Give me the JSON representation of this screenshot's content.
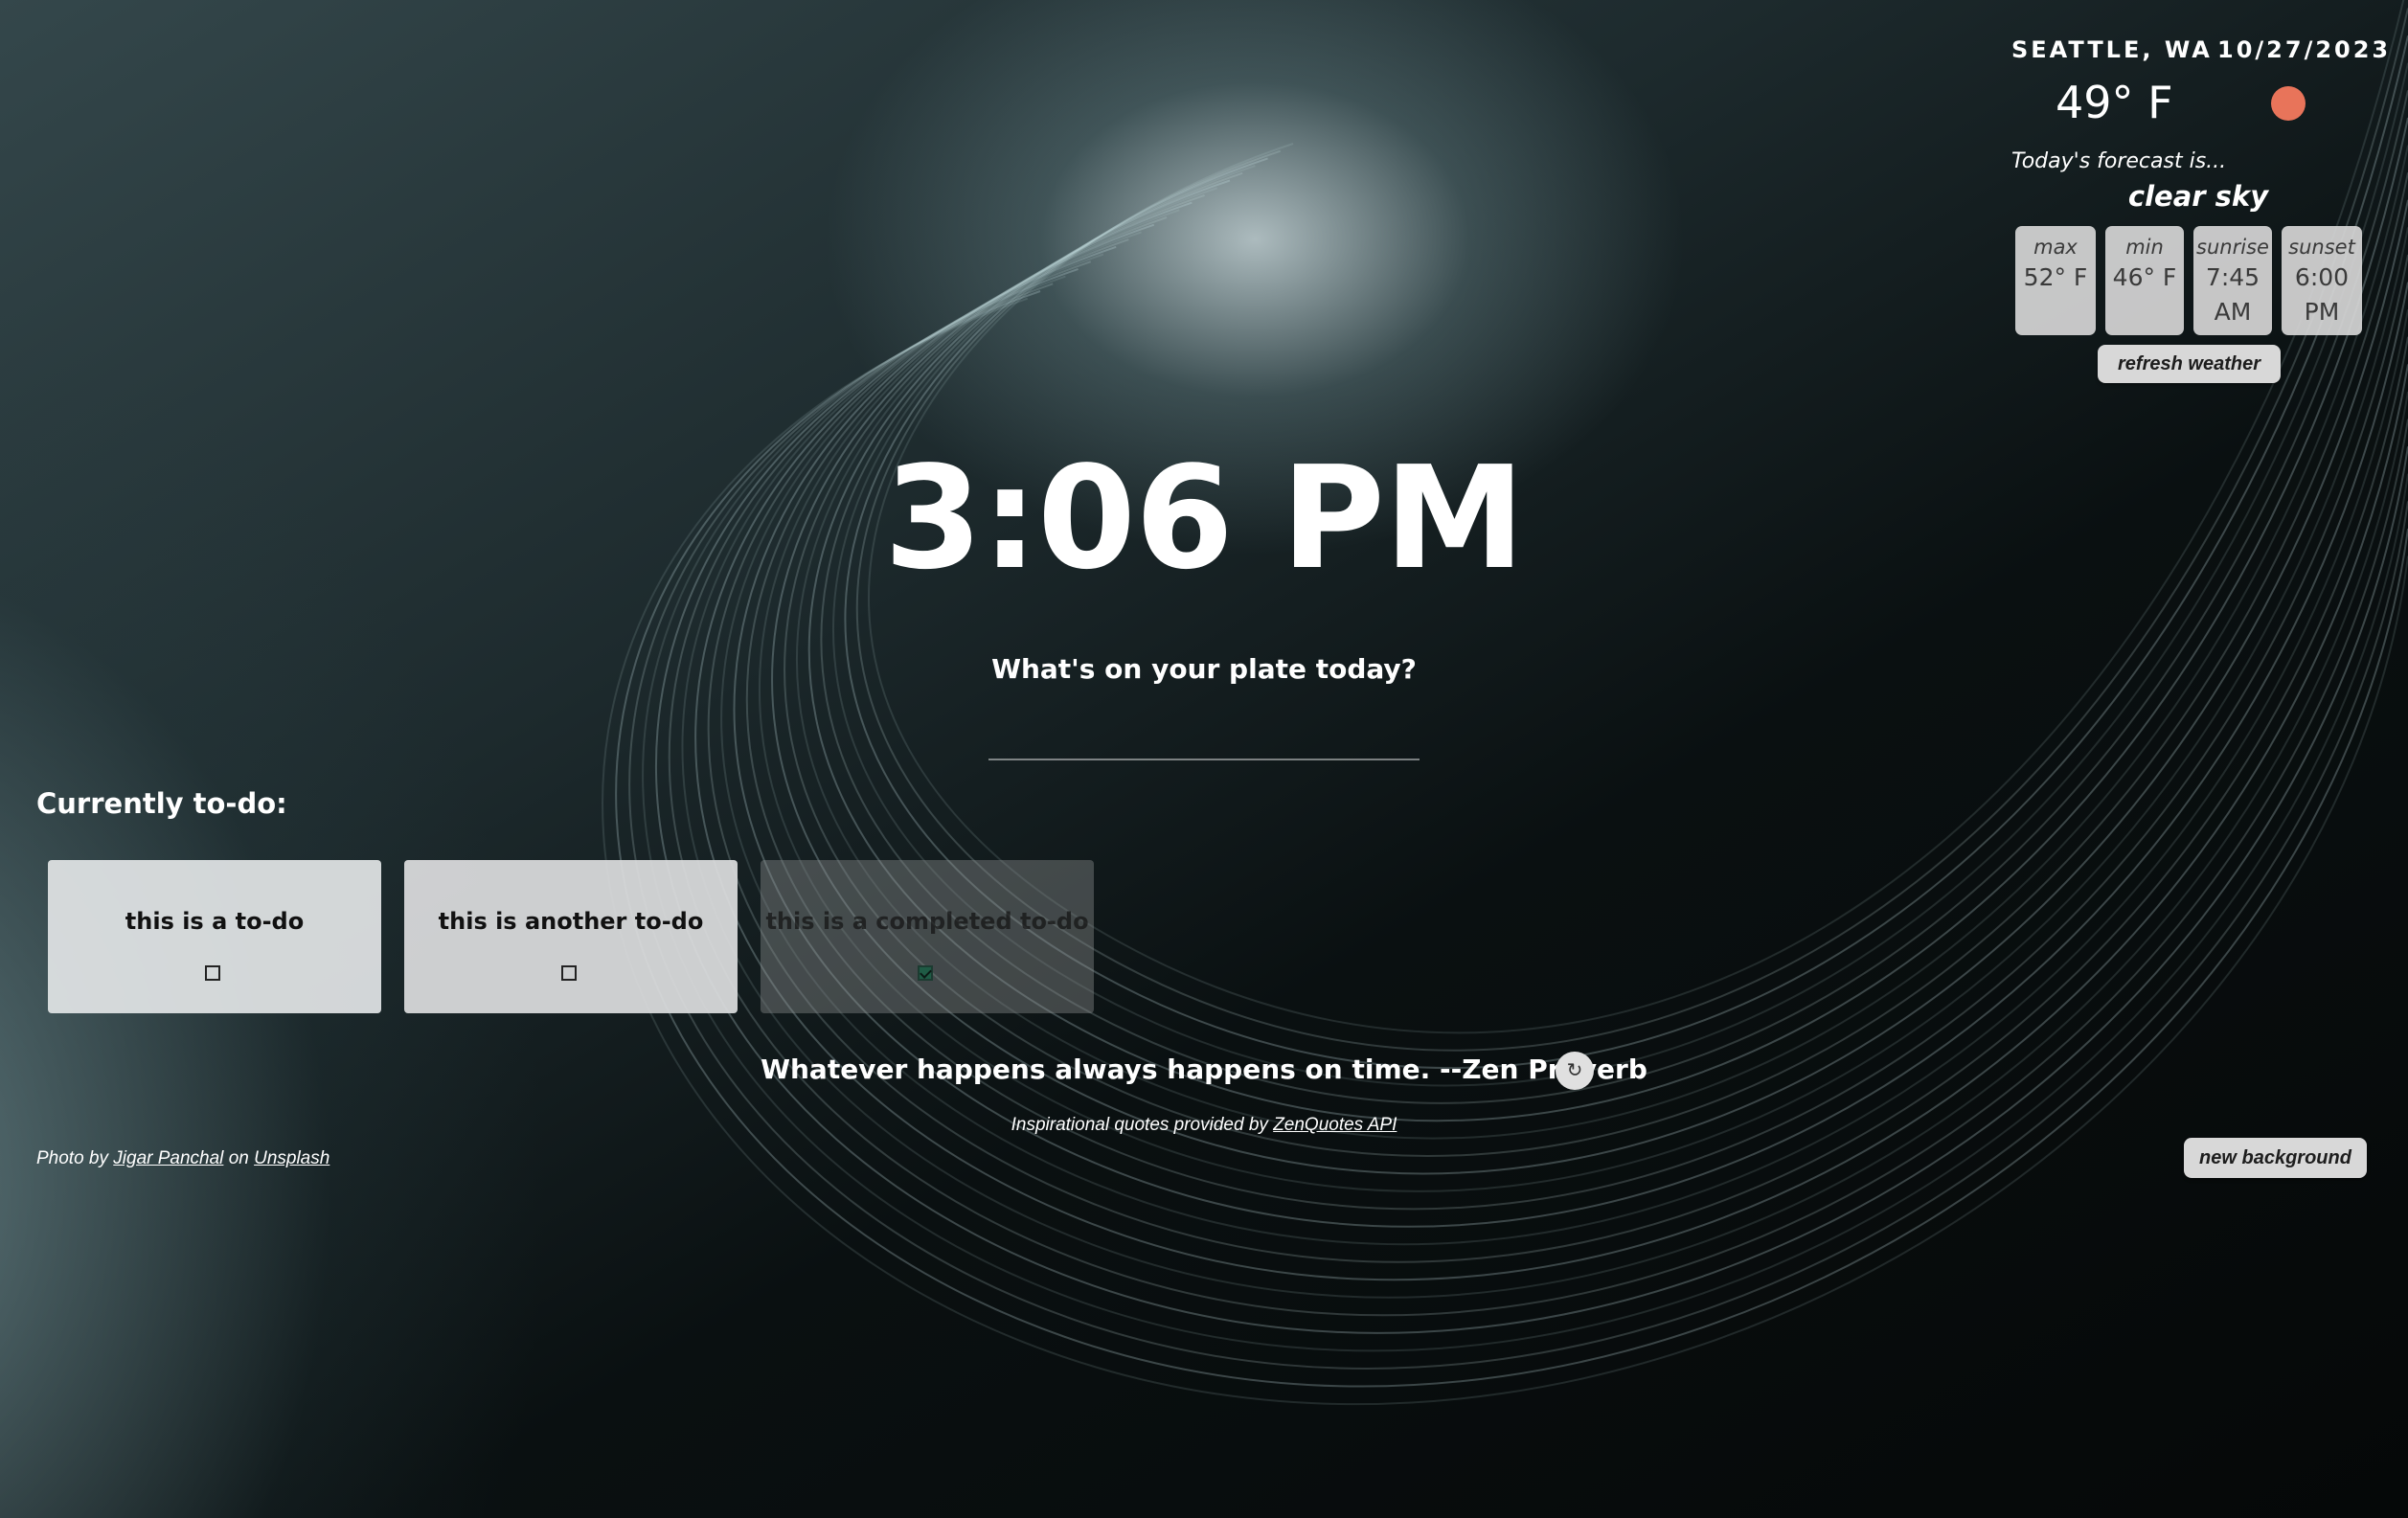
{
  "weather": {
    "location": "SEATTLE, WA",
    "date": "10/27/2023",
    "temperature": "49° F",
    "forecast_label": "Today's forecast is...",
    "description": "clear sky",
    "icon": "sun-icon",
    "icon_color": "#e8745a",
    "stats": [
      {
        "label": "max",
        "value": "52° F"
      },
      {
        "label": "min",
        "value": "46° F"
      },
      {
        "label": "sunrise",
        "value": "7:45 AM"
      },
      {
        "label": "sunset",
        "value": "6:00 PM"
      }
    ],
    "refresh_label": "refresh weather"
  },
  "clock": {
    "time": "3:06 PM"
  },
  "todo_input": {
    "prompt": "What's on your plate today?",
    "value": ""
  },
  "todos": {
    "heading": "Currently to-do:",
    "items": [
      {
        "text": "this is a to-do",
        "completed": false
      },
      {
        "text": "this is another to-do",
        "completed": false
      },
      {
        "text": "this is a completed to-do",
        "completed": true
      }
    ]
  },
  "quote": {
    "text": "Whatever happens always happens on time. --Zen Proverb",
    "refresh_icon": "refresh-icon",
    "credit_prefix": "Inspirational quotes provided by",
    "credit_link": "ZenQuotes API"
  },
  "photo_credit": {
    "prefix": "Photo by",
    "author": "Jigar Panchal",
    "middle": "on",
    "site": "Unsplash"
  },
  "background": {
    "new_label": "new background"
  }
}
